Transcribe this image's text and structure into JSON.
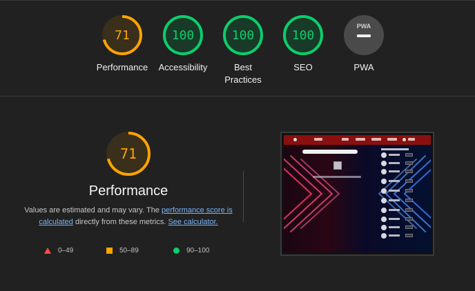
{
  "colors": {
    "good": "#0cce6b",
    "average": "#ffa400",
    "poor": "#ff4e42",
    "pwa_gray": "#4a4a4a"
  },
  "score_gauges": [
    {
      "label": "Performance",
      "score": 71,
      "rating": "average"
    },
    {
      "label": "Accessibility",
      "score": 100,
      "rating": "good"
    },
    {
      "label_line1": "Best",
      "label_line2": "Practices",
      "score": 100,
      "rating": "good"
    },
    {
      "label": "SEO",
      "score": 100,
      "rating": "good"
    },
    {
      "label": "PWA",
      "badge": "PWA",
      "rating": "not-applicable"
    }
  ],
  "performance_section": {
    "score": 71,
    "title": "Performance",
    "desc_prefix": "Values are estimated and may vary. The ",
    "link_score": "performance score is calculated",
    "desc_middle": " directly from these metrics. ",
    "link_calculator": "See calculator."
  },
  "legend": [
    {
      "shape": "triangle-icon",
      "range": "0–49",
      "color": "#ff4e42"
    },
    {
      "shape": "square-icon",
      "range": "50–89",
      "color": "#ffa400"
    },
    {
      "shape": "circle-icon",
      "range": "90–100",
      "color": "#0cce6b"
    }
  ],
  "screenshot": {
    "description_alt": "Final screenshot"
  }
}
